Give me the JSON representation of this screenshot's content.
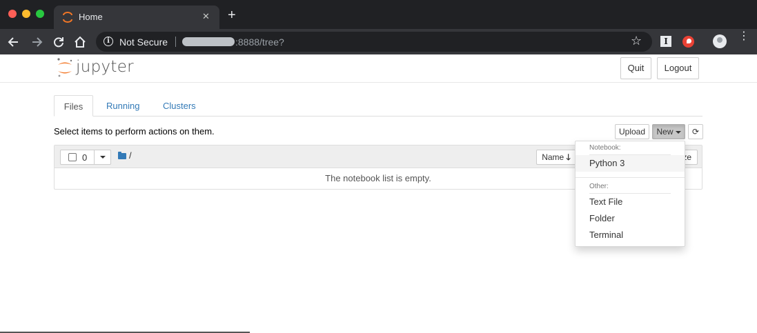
{
  "browser": {
    "tab_title": "Home",
    "tab_close_glyph": "✕",
    "new_tab_glyph": "+",
    "security_label": "Not Secure",
    "url_suffix": ":8888/tree?",
    "menu_glyph": "⋮",
    "bookmark_glyph": "☆",
    "extension_letter": "I"
  },
  "header": {
    "brand": "jupyter",
    "quit_label": "Quit",
    "logout_label": "Logout",
    "logo_color": "#f37726"
  },
  "tabs": [
    {
      "label": "Files"
    },
    {
      "label": "Running"
    },
    {
      "label": "Clusters"
    }
  ],
  "toolbar": {
    "instructions": "Select items to perform actions on them.",
    "upload_label": "Upload",
    "new_label": "New",
    "refresh_glyph": "⟳"
  },
  "list": {
    "selected_count": "0",
    "breadcrumb": "/",
    "sort_name_label": "Name",
    "sort_arrow": "🡓",
    "size_label": "ze",
    "empty_message": "The notebook list is empty."
  },
  "new_menu": {
    "notebook_header": "Notebook:",
    "notebook_items": [
      "Python 3"
    ],
    "other_header": "Other:",
    "other_items": [
      "Text File",
      "Folder",
      "Terminal"
    ]
  },
  "colors": {
    "link": "#337ab7",
    "chrome_dark": "#202124",
    "chrome_toolbar": "#35363a"
  }
}
